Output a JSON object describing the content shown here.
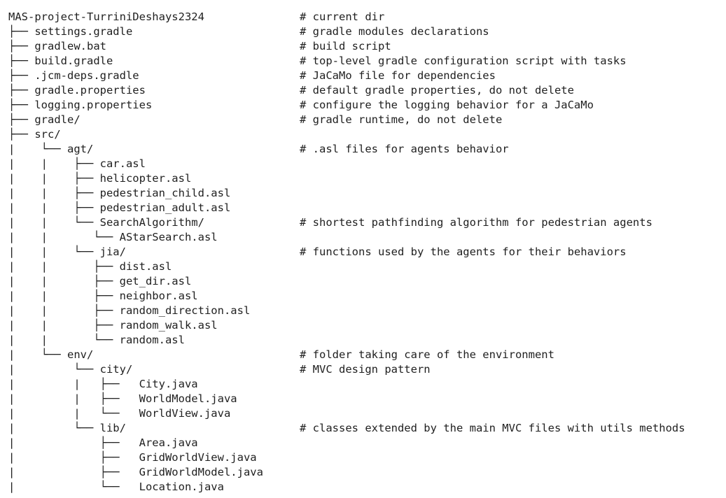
{
  "lines": [
    {
      "path": "MAS-project-TurriniDeshays2324",
      "comment": "# current dir"
    },
    {
      "path": "├── settings.gradle",
      "comment": "# gradle modules declarations"
    },
    {
      "path": "├── gradlew.bat",
      "comment": "# build script"
    },
    {
      "path": "├── build.gradle",
      "comment": "# top-level gradle configuration script with tasks"
    },
    {
      "path": "├── .jcm-deps.gradle",
      "comment": "# JaCaMo file for dependencies"
    },
    {
      "path": "├── gradle.properties",
      "comment": "# default gradle properties, do not delete"
    },
    {
      "path": "├── logging.properties",
      "comment": "# configure the logging behavior for a JaCaMo"
    },
    {
      "path": "├── gradle/",
      "comment": "# gradle runtime, do not delete"
    },
    {
      "path": "├── src/",
      "comment": ""
    },
    {
      "path": "|    └── agt/",
      "comment": "# .asl files for agents behavior"
    },
    {
      "path": "|    |    ├── car.asl",
      "comment": ""
    },
    {
      "path": "|    |    ├── helicopter.asl",
      "comment": ""
    },
    {
      "path": "|    |    ├── pedestrian_child.asl",
      "comment": ""
    },
    {
      "path": "|    |    ├── pedestrian_adult.asl",
      "comment": ""
    },
    {
      "path": "|    |    └── SearchAlgorithm/",
      "comment": "# shortest pathfinding algorithm for pedestrian agents"
    },
    {
      "path": "|    |       └── AStarSearch.asl",
      "comment": ""
    },
    {
      "path": "|    |    └── jia/",
      "comment": "# functions used by the agents for their behaviors"
    },
    {
      "path": "|    |       ├── dist.asl",
      "comment": ""
    },
    {
      "path": "|    |       ├── get_dir.asl",
      "comment": ""
    },
    {
      "path": "|    |       ├── neighbor.asl",
      "comment": ""
    },
    {
      "path": "|    |       ├── random_direction.asl",
      "comment": ""
    },
    {
      "path": "|    |       ├── random_walk.asl",
      "comment": ""
    },
    {
      "path": "|    |       └── random.asl",
      "comment": ""
    },
    {
      "path": "|    └── env/",
      "comment": "# folder taking care of the environment"
    },
    {
      "path": "|         └── city/",
      "comment": "# MVC design pattern"
    },
    {
      "path": "|         |   ├──   City.java",
      "comment": ""
    },
    {
      "path": "|         |   ├──   WorldModel.java",
      "comment": ""
    },
    {
      "path": "|         |   └──   WorldView.java",
      "comment": ""
    },
    {
      "path": "|         └── lib/",
      "comment": "# classes extended by the main MVC files with utils methods"
    },
    {
      "path": "|             ├──   Area.java",
      "comment": ""
    },
    {
      "path": "|             ├──   GridWorldView.java",
      "comment": ""
    },
    {
      "path": "|             ├──   GridWorldModel.java",
      "comment": ""
    },
    {
      "path": "|             └──   Location.java",
      "comment": ""
    }
  ]
}
